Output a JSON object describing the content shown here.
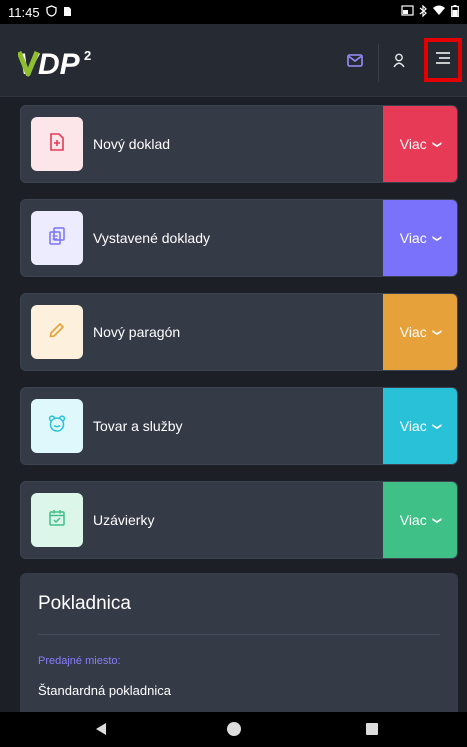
{
  "status_bar": {
    "time": "11:45"
  },
  "appbar": {
    "logo_text": "VDP",
    "logo_superscript": "2"
  },
  "cards": [
    {
      "label": "Nový doklad",
      "more_label": "Viac",
      "icon": "file-plus-icon",
      "accent": "#e63a56",
      "icon_bg": "#fde6ea",
      "icon_color": "#e63a56"
    },
    {
      "label": "Vystavené doklady",
      "more_label": "Viac",
      "icon": "copy-documents-icon",
      "accent": "#7b72fb",
      "icon_bg": "#ececfe",
      "icon_color": "#7b72fb"
    },
    {
      "label": "Nový paragón",
      "more_label": "Viac",
      "icon": "pencil-icon",
      "accent": "#e6a13a",
      "icon_bg": "#fdf0dd",
      "icon_color": "#e6a13a"
    },
    {
      "label": "Tovar a služby",
      "more_label": "Viac",
      "icon": "bear-face-icon",
      "accent": "#29c1d8",
      "icon_bg": "#dff8fc",
      "icon_color": "#29c1d8"
    },
    {
      "label": "Uzávierky",
      "more_label": "Viac",
      "icon": "calendar-check-icon",
      "accent": "#3fc087",
      "icon_bg": "#ddf6ea",
      "icon_color": "#3fc087"
    }
  ],
  "panel": {
    "title": "Pokladnica",
    "label": "Predajné miesto:",
    "value": "Štandardná pokladnica"
  }
}
